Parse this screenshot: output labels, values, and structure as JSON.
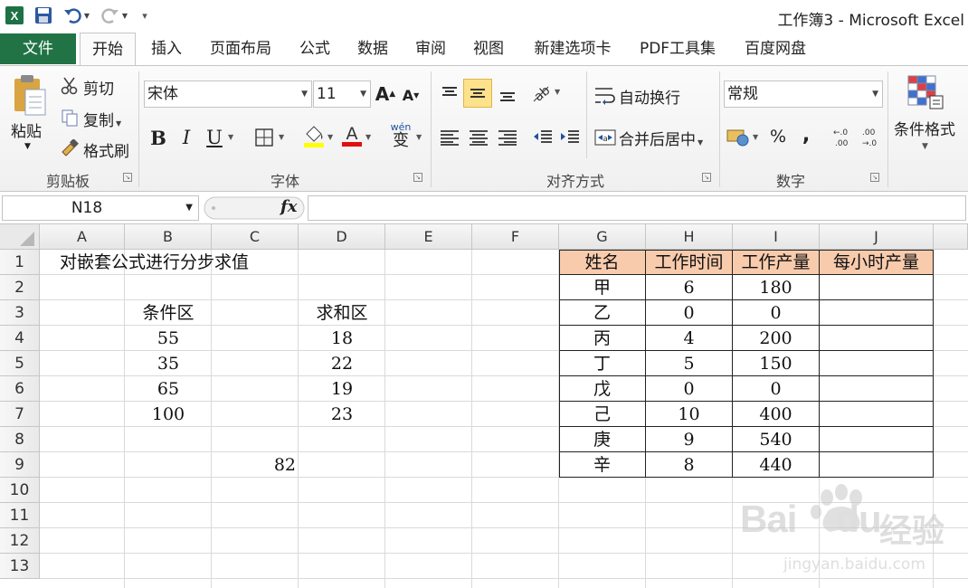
{
  "window": {
    "title": "工作簿3 - Microsoft Excel"
  },
  "tabs": [
    {
      "label": "文件"
    },
    {
      "label": "开始"
    },
    {
      "label": "插入"
    },
    {
      "label": "页面布局"
    },
    {
      "label": "公式"
    },
    {
      "label": "数据"
    },
    {
      "label": "审阅"
    },
    {
      "label": "视图"
    },
    {
      "label": "新建选项卡"
    },
    {
      "label": "PDF工具集"
    },
    {
      "label": "百度网盘"
    }
  ],
  "ribbon": {
    "clipboard": {
      "paste": "粘贴",
      "cut": "剪切",
      "copy": "复制",
      "format_painter": "格式刷",
      "label": "剪贴板"
    },
    "font": {
      "name": "宋体",
      "size": "11",
      "label": "字体",
      "bold": "B",
      "italic": "I",
      "underline": "U",
      "phonetic": "wén",
      "phonetic_char": "变"
    },
    "alignment": {
      "wrap": "自动换行",
      "merge": "合并后居中",
      "label": "对齐方式"
    },
    "number": {
      "format": "常规",
      "percent": "%",
      "comma": ",",
      "label": "数字"
    },
    "styles": {
      "conditional": "条件格式"
    }
  },
  "formula_bar": {
    "name_box": "N18",
    "fx": "fx",
    "formula": ""
  },
  "grid": {
    "columns": [
      "A",
      "B",
      "C",
      "D",
      "E",
      "F",
      "G",
      "H",
      "I",
      "J"
    ],
    "rows": [
      "1",
      "2",
      "3",
      "4",
      "5",
      "6",
      "7",
      "8",
      "9",
      "10",
      "11",
      "12",
      "13"
    ],
    "cells": {
      "A1": "对嵌套公式进行分步求值",
      "B3": "条件区",
      "D3": "求和区",
      "B4": "55",
      "D4": "18",
      "B5": "35",
      "D5": "22",
      "B6": "65",
      "D6": "19",
      "B7": "100",
      "D7": "23",
      "C9": "82"
    },
    "table": {
      "headers": [
        "姓名",
        "工作时间",
        "工作产量",
        "每小时产量"
      ],
      "rows": [
        [
          "甲",
          "6",
          "180",
          ""
        ],
        [
          "乙",
          "0",
          "0",
          ""
        ],
        [
          "丙",
          "4",
          "200",
          ""
        ],
        [
          "丁",
          "5",
          "150",
          ""
        ],
        [
          "戊",
          "0",
          "0",
          ""
        ],
        [
          "己",
          "10",
          "400",
          ""
        ],
        [
          "庚",
          "9",
          "540",
          ""
        ],
        [
          "辛",
          "8",
          "440",
          ""
        ]
      ],
      "header_color": "#f8cbad"
    }
  },
  "watermark": {
    "brand": "Bai",
    "brand2": "du",
    "brand_cn": "经验",
    "url": "jingyan.baidu.com"
  },
  "colors": {
    "file_tab": "#217346",
    "accent_selected": "#fde28b"
  }
}
